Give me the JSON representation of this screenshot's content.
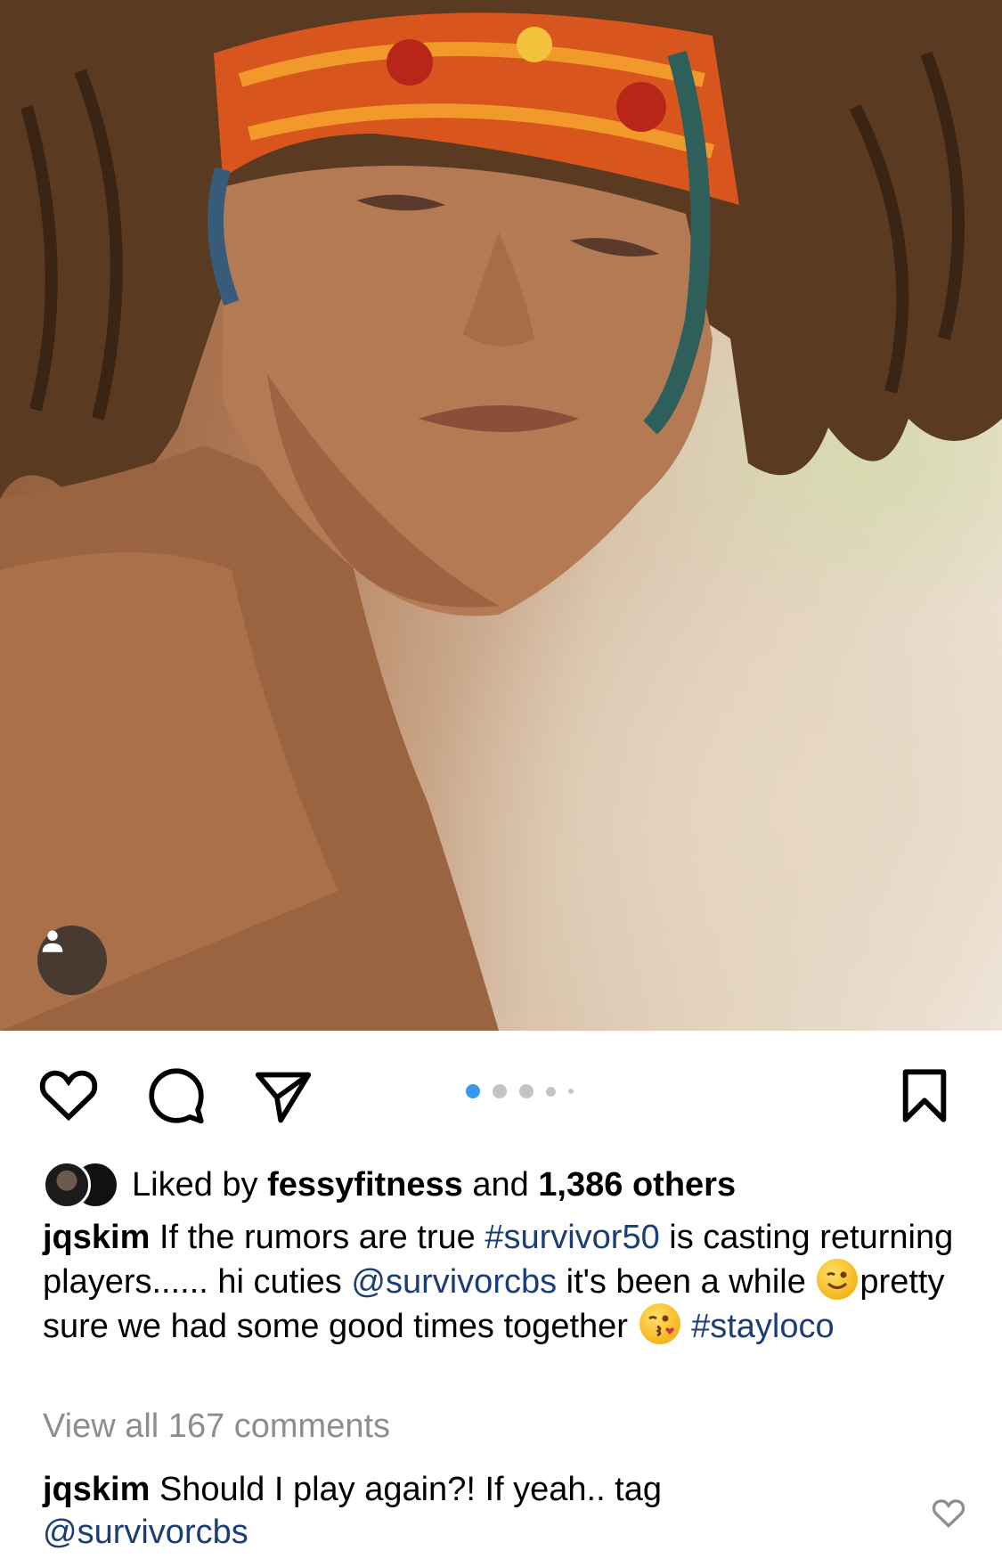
{
  "post": {
    "media": {
      "description_icon": "user-tag-icon",
      "carousel": {
        "total": 5,
        "active": 1
      }
    },
    "actions": {
      "like_icon": "heart-outline-icon",
      "comment_icon": "comment-bubble-icon",
      "share_icon": "paper-plane-icon",
      "save_icon": "bookmark-outline-icon"
    },
    "likes": {
      "prefix": "Liked by ",
      "user": "fessyfitness",
      "middle": " and ",
      "count": "1,386 others"
    },
    "caption": {
      "username": "jqskim",
      "text1": " If the rumors are true ",
      "hashtag1": "#survivor50",
      "text2": " is casting returning players...... hi cuties ",
      "mention1": "@survivorcbs",
      "text3": " it's been a while ",
      "text4": "pretty sure we had some good times together ",
      "hashtag2": "#stayloco"
    },
    "view_all_comments": "View all 167 comments",
    "top_comment": {
      "username": "jqskim",
      "text": " Should I play again?! If yeah.. tag ",
      "mention": "@survivorcbs"
    },
    "colors": {
      "link": "#1c3e78",
      "muted": "#8e8e8e",
      "active_dot": "#3897f0"
    }
  }
}
